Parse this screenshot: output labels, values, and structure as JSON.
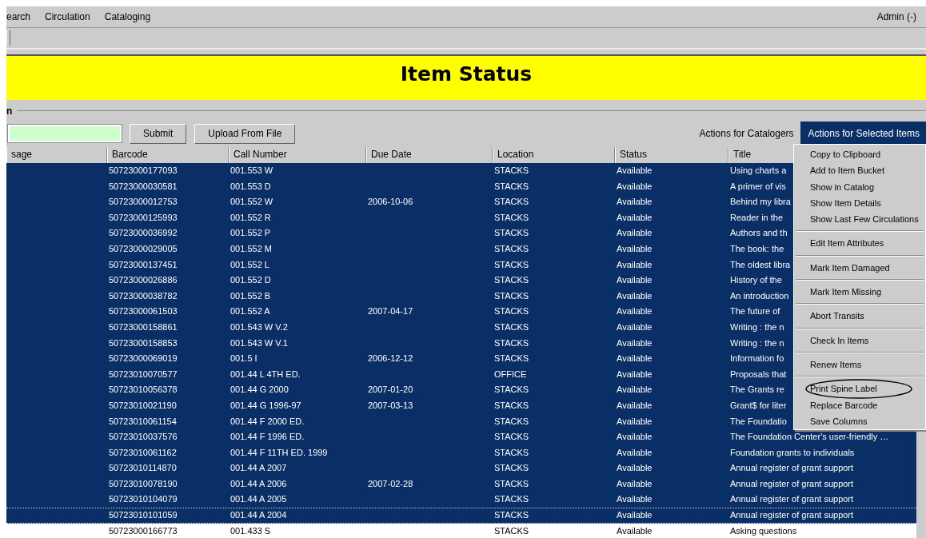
{
  "menu_bar": {
    "items": [
      "earch",
      "Circulation",
      "Cataloging"
    ],
    "user": "Admin (-)"
  },
  "banner": {
    "title": "Item Status"
  },
  "section": {
    "label": "n"
  },
  "controls": {
    "buttons": [
      "Submit",
      "Upload From File"
    ]
  },
  "tabs": [
    {
      "label": "Actions for Catalogers",
      "selected": false
    },
    {
      "label": "Actions for Selected Items",
      "selected": true
    }
  ],
  "table": {
    "columns": [
      "sage",
      "Barcode",
      "Call Number",
      "Due Date",
      "Location",
      "Status",
      "Title"
    ],
    "rows": [
      {
        "selected": true,
        "focused": false,
        "cells": [
          "",
          "50723000177093",
          "001.553 W",
          "",
          "STACKS",
          "Available",
          "Using charts a"
        ]
      },
      {
        "selected": true,
        "focused": false,
        "cells": [
          "",
          "50723000030581",
          "001.553 D",
          "",
          "STACKS",
          "Available",
          "A primer of vis"
        ]
      },
      {
        "selected": true,
        "focused": false,
        "cells": [
          "",
          "50723000012753",
          "001.552 W",
          "2006-10-06",
          "STACKS",
          "Available",
          "Behind my libra"
        ]
      },
      {
        "selected": true,
        "focused": false,
        "cells": [
          "",
          "50723000125993",
          "001.552 R",
          "",
          "STACKS",
          "Available",
          "Reader in the"
        ]
      },
      {
        "selected": true,
        "focused": false,
        "cells": [
          "",
          "50723000036992",
          "001.552 P",
          "",
          "STACKS",
          "Available",
          "Authors and th"
        ]
      },
      {
        "selected": true,
        "focused": false,
        "cells": [
          "",
          "50723000029005",
          "001.552 M",
          "",
          "STACKS",
          "Available",
          "The book: the"
        ]
      },
      {
        "selected": true,
        "focused": false,
        "cells": [
          "",
          "50723000137451",
          "001.552 L",
          "",
          "STACKS",
          "Available",
          "The oldest libra"
        ]
      },
      {
        "selected": true,
        "focused": false,
        "cells": [
          "",
          "50723000026886",
          "001.552 D",
          "",
          "STACKS",
          "Available",
          "History of the"
        ]
      },
      {
        "selected": true,
        "focused": false,
        "cells": [
          "",
          "50723000038782",
          "001.552 B",
          "",
          "STACKS",
          "Available",
          "An introduction"
        ]
      },
      {
        "selected": true,
        "focused": false,
        "cells": [
          "",
          "50723000061503",
          "001.552 A",
          "2007-04-17",
          "STACKS",
          "Available",
          "The future of"
        ]
      },
      {
        "selected": true,
        "focused": false,
        "cells": [
          "",
          "50723000158861",
          "001.543 W V.2",
          "",
          "STACKS",
          "Available",
          "Writing : the n"
        ]
      },
      {
        "selected": true,
        "focused": false,
        "cells": [
          "",
          "50723000158853",
          "001.543 W V.1",
          "",
          "STACKS",
          "Available",
          "Writing : the n"
        ]
      },
      {
        "selected": true,
        "focused": false,
        "cells": [
          "",
          "50723000069019",
          "001.5 I",
          "2006-12-12",
          "STACKS",
          "Available",
          "Information fo"
        ]
      },
      {
        "selected": true,
        "focused": false,
        "cells": [
          "",
          "50723010070577",
          "001.44 L 4TH ED.",
          "",
          "OFFICE",
          "Available",
          "Proposals that"
        ]
      },
      {
        "selected": true,
        "focused": false,
        "cells": [
          "",
          "50723010056378",
          "001.44 G 2000",
          "2007-01-20",
          "STACKS",
          "Available",
          "The Grants re"
        ]
      },
      {
        "selected": true,
        "focused": false,
        "cells": [
          "",
          "50723010021190",
          "001.44 G 1996-97",
          "2007-03-13",
          "STACKS",
          "Available",
          "Grant$ for liter"
        ]
      },
      {
        "selected": true,
        "focused": false,
        "cells": [
          "",
          "50723010061154",
          "001.44 F 2000 ED.",
          "",
          "STACKS",
          "Available",
          "The Foundatio"
        ]
      },
      {
        "selected": true,
        "focused": false,
        "cells": [
          "",
          "50723010037576",
          "001.44 F 1996 ED.",
          "",
          "STACKS",
          "Available",
          "The Foundation Center's user-friendly …"
        ]
      },
      {
        "selected": true,
        "focused": false,
        "cells": [
          "",
          "50723010061162",
          "001.44 F 11TH ED. 1999",
          "",
          "STACKS",
          "Available",
          "Foundation grants to individuals"
        ]
      },
      {
        "selected": true,
        "focused": false,
        "cells": [
          "",
          "50723010114870",
          "001.44 A 2007",
          "",
          "STACKS",
          "Available",
          "Annual register of grant support"
        ]
      },
      {
        "selected": true,
        "focused": false,
        "cells": [
          "",
          "50723010078190",
          "001.44 A 2006",
          "2007-02-28",
          "STACKS",
          "Available",
          "Annual register of grant support"
        ]
      },
      {
        "selected": true,
        "focused": false,
        "cells": [
          "",
          "50723010104079",
          "001.44 A 2005",
          "",
          "STACKS",
          "Available",
          "Annual register of grant support"
        ]
      },
      {
        "selected": true,
        "focused": true,
        "cells": [
          "",
          "50723010101059",
          "001.44 A 2004",
          "",
          "STACKS",
          "Available",
          "Annual register of grant support"
        ]
      },
      {
        "selected": false,
        "focused": false,
        "cells": [
          "",
          "50723000166773",
          "001.433 S",
          "",
          "STACKS",
          "Available",
          "Asking questions"
        ]
      }
    ]
  },
  "context_menu": {
    "groups": [
      [
        {
          "label": "Copy to Clipboard",
          "circled": false
        },
        {
          "label": "Add to Item Bucket",
          "circled": false
        },
        {
          "label": "Show in Catalog",
          "circled": false
        },
        {
          "label": "Show Item Details",
          "circled": false
        },
        {
          "label": "Show Last Few Circulations",
          "circled": false
        }
      ],
      [
        {
          "label": "Edit Item Attributes",
          "circled": false
        }
      ],
      [
        {
          "label": "Mark Item Damaged",
          "circled": false
        }
      ],
      [
        {
          "label": "Mark Item Missing",
          "circled": false
        }
      ],
      [
        {
          "label": "Abort Transits",
          "circled": false
        }
      ],
      [
        {
          "label": "Check In Items",
          "circled": false
        }
      ],
      [
        {
          "label": "Renew Items",
          "circled": false
        }
      ],
      [
        {
          "label": "Print Spine Label",
          "circled": true
        },
        {
          "label": "Replace Barcode",
          "circled": false
        },
        {
          "label": "Save Columns",
          "circled": false
        }
      ]
    ]
  }
}
